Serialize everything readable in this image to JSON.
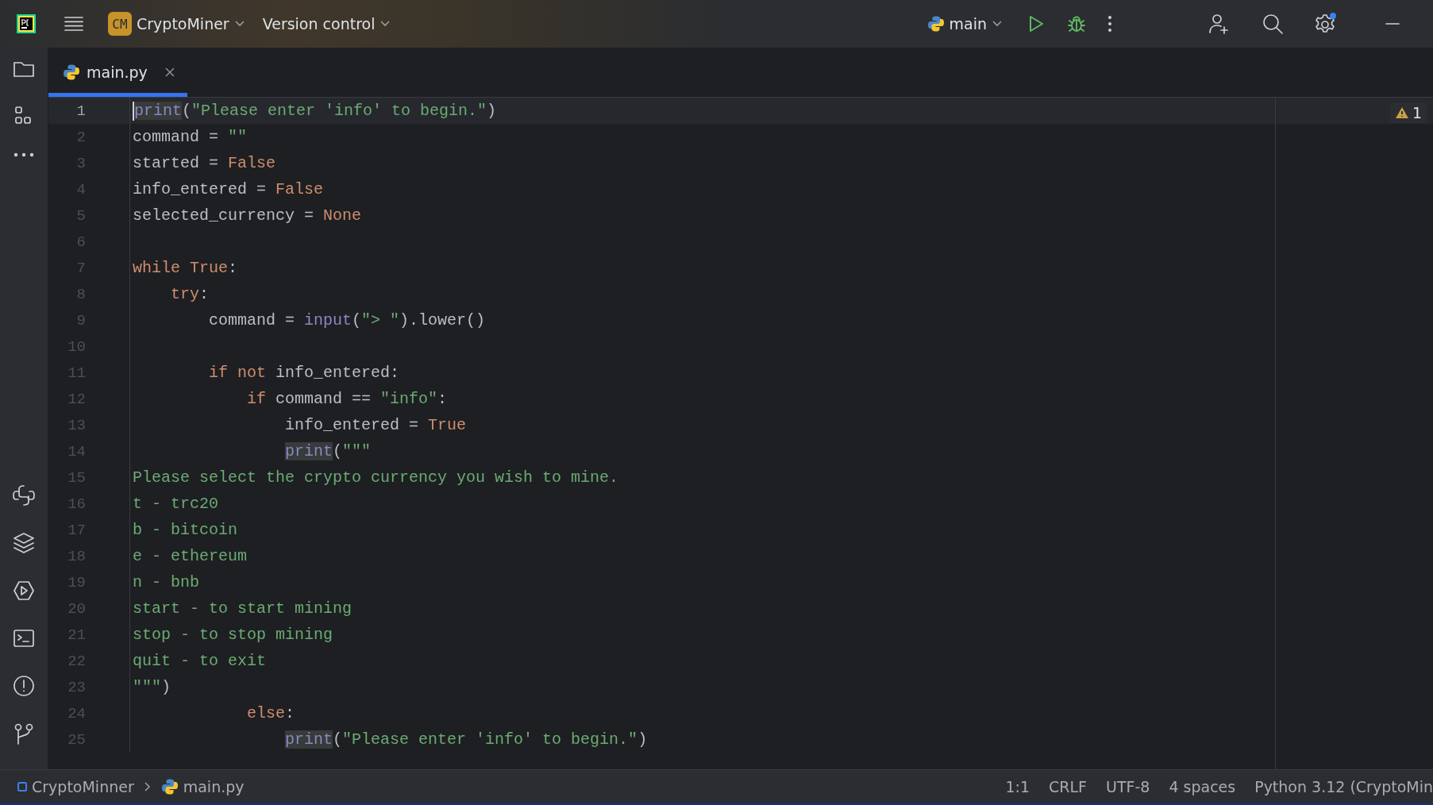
{
  "toolbar": {
    "app_badge": "CM",
    "project": "CryptoMiner",
    "vcs": "Version control",
    "run_config": "main"
  },
  "tabs": [
    {
      "label": "main.py",
      "selected": true
    }
  ],
  "editor": {
    "warning_count": "1",
    "lines": [
      {
        "number": "1",
        "current": true,
        "tokens": [
          {
            "kind": "usage",
            "text": "print"
          },
          {
            "kind": "plain",
            "text": "("
          },
          {
            "kind": "string",
            "text": "\"Please enter 'info' to begin.\""
          },
          {
            "kind": "plain",
            "text": ")"
          }
        ]
      },
      {
        "number": "2",
        "current": false,
        "tokens": [
          {
            "kind": "plain",
            "text": "command = "
          },
          {
            "kind": "string",
            "text": "\"\""
          }
        ]
      },
      {
        "number": "3",
        "current": false,
        "tokens": [
          {
            "kind": "plain",
            "text": "started = "
          },
          {
            "kind": "keyword",
            "text": "False"
          }
        ]
      },
      {
        "number": "4",
        "current": false,
        "tokens": [
          {
            "kind": "plain",
            "text": "info_entered = "
          },
          {
            "kind": "keyword",
            "text": "False"
          }
        ]
      },
      {
        "number": "5",
        "current": false,
        "tokens": [
          {
            "kind": "plain",
            "text": "selected_currency = "
          },
          {
            "kind": "keyword",
            "text": "None"
          }
        ]
      },
      {
        "number": "6",
        "current": false
      },
      {
        "number": "7",
        "current": false,
        "tokens": [
          {
            "kind": "keyword",
            "text": "while True"
          },
          {
            "kind": "plain",
            "text": ":"
          }
        ]
      },
      {
        "number": "8",
        "current": false,
        "tokens": [
          {
            "kind": "keyword",
            "text": "    try"
          },
          {
            "kind": "plain",
            "text": ":"
          }
        ]
      },
      {
        "number": "9",
        "current": false,
        "tokens": [
          {
            "kind": "plain",
            "text": "        command = "
          },
          {
            "kind": "builtin",
            "text": "input"
          },
          {
            "kind": "plain",
            "text": "("
          },
          {
            "kind": "string",
            "text": "\"> \""
          },
          {
            "kind": "plain",
            "text": ").lower()"
          }
        ]
      },
      {
        "number": "10",
        "current": false
      },
      {
        "number": "11",
        "current": false,
        "tokens": [
          {
            "kind": "keyword",
            "text": "        if not "
          },
          {
            "kind": "plain",
            "text": "info_entered:"
          }
        ]
      },
      {
        "number": "12",
        "current": false,
        "tokens": [
          {
            "kind": "keyword",
            "text": "            if "
          },
          {
            "kind": "plain",
            "text": "command == "
          },
          {
            "kind": "string",
            "text": "\"info\""
          },
          {
            "kind": "plain",
            "text": ":"
          }
        ]
      },
      {
        "number": "13",
        "current": false,
        "tokens": [
          {
            "kind": "plain",
            "text": "                info_entered = "
          },
          {
            "kind": "keyword",
            "text": "True"
          }
        ]
      },
      {
        "number": "14",
        "current": false,
        "tokens": [
          {
            "kind": "usage",
            "text": "                print"
          },
          {
            "kind": "plain",
            "text": "("
          },
          {
            "kind": "string",
            "text": "\"\"\""
          }
        ]
      },
      {
        "number": "15",
        "current": false,
        "tokens": [
          {
            "kind": "string",
            "text": "Please select the crypto currency you wish to mine."
          }
        ]
      },
      {
        "number": "16",
        "current": false,
        "tokens": [
          {
            "kind": "string",
            "text": "t - trc20"
          }
        ]
      },
      {
        "number": "17",
        "current": false,
        "tokens": [
          {
            "kind": "string",
            "text": "b - bitcoin"
          }
        ]
      },
      {
        "number": "18",
        "current": false,
        "tokens": [
          {
            "kind": "string",
            "text": "e - ethereum"
          }
        ]
      },
      {
        "number": "19",
        "current": false,
        "tokens": [
          {
            "kind": "string",
            "text": "n - bnb"
          }
        ]
      },
      {
        "number": "20",
        "current": false,
        "tokens": [
          {
            "kind": "string",
            "text": "start - to start mining"
          }
        ]
      },
      {
        "number": "21",
        "current": false,
        "tokens": [
          {
            "kind": "string",
            "text": "stop - to stop mining"
          }
        ]
      },
      {
        "number": "22",
        "current": false,
        "tokens": [
          {
            "kind": "string",
            "text": "quit - to exit"
          }
        ]
      },
      {
        "number": "23",
        "current": false,
        "tokens": [
          {
            "kind": "string",
            "text": "\"\"\""
          },
          {
            "kind": "plain",
            "text": ")"
          }
        ]
      },
      {
        "number": "24",
        "current": false,
        "tokens": [
          {
            "kind": "keyword",
            "text": "            else"
          },
          {
            "kind": "plain",
            "text": ":"
          }
        ]
      },
      {
        "number": "25",
        "current": false,
        "tokens": [
          {
            "kind": "usage",
            "text": "                print"
          },
          {
            "kind": "plain",
            "text": "("
          },
          {
            "kind": "string",
            "text": "\"Please enter 'info' to begin.\""
          },
          {
            "kind": "plain",
            "text": ")"
          }
        ]
      }
    ]
  },
  "status_bar": {
    "breadcrumbs": [
      "CryptoMinner",
      "main.py"
    ],
    "items": [
      "1:1",
      "CRLF",
      "UTF-8",
      "4 spaces",
      "Python 3.12 (CryptoMin"
    ]
  }
}
